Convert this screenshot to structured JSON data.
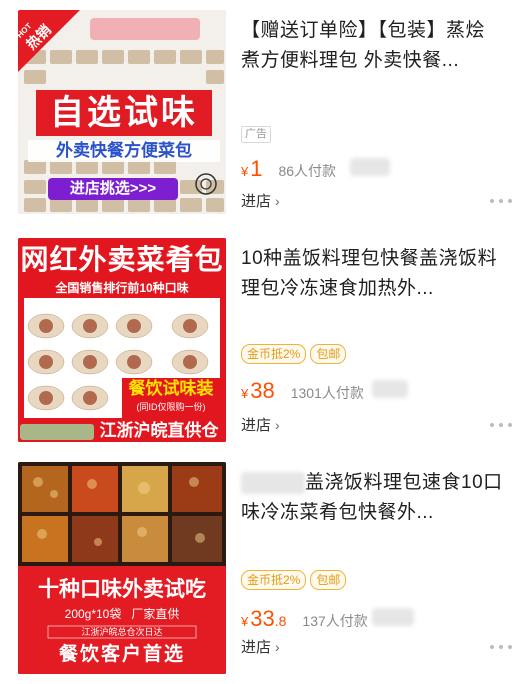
{
  "products": [
    {
      "title": "【赠送订单险】【包装】蒸烩煮方便料理包 外卖快餐...",
      "ad_label": "广告",
      "price_symbol": "¥",
      "price_int": "1",
      "price_dec": "",
      "paid": "86人付款",
      "shop_label": "进店",
      "image": {
        "hot_label": "热销",
        "hot_small": "HOT",
        "main": "自选试味",
        "sub": "外卖快餐方便菜包",
        "cta": "进店挑选>>>"
      }
    },
    {
      "title": "10种盖饭料理包快餐盖浇饭料理包冷冻速食加热外...",
      "badges": [
        "金币抵2%",
        "包邮"
      ],
      "price_symbol": "¥",
      "price_int": "38",
      "price_dec": "",
      "paid": "1301人付款",
      "shop_label": "进店",
      "image": {
        "headline": "网红外卖菜肴包",
        "rank": "全国销售排行前10种口味",
        "trial": "餐饮试味装",
        "trial_note": "(同ID仅限购一份)",
        "supply": "江浙沪皖直供仓"
      }
    },
    {
      "title": "盖浇饭料理包速食10口味冷冻菜肴包快餐外...",
      "badges": [
        "金币抵2%",
        "包邮"
      ],
      "price_symbol": "¥",
      "price_int": "33",
      "price_dec": ".8",
      "paid": "137人付款",
      "shop_label": "进店",
      "image": {
        "headline": "十种口味外卖试吃",
        "spec": "200g*10袋   厂家直供",
        "ship": "江浙沪皖总仓次日达",
        "footer": "餐饮客户首选"
      }
    }
  ],
  "colors": {
    "price": "#ff5000",
    "badge": "#e29b10",
    "red_banner": "#d9161e"
  }
}
